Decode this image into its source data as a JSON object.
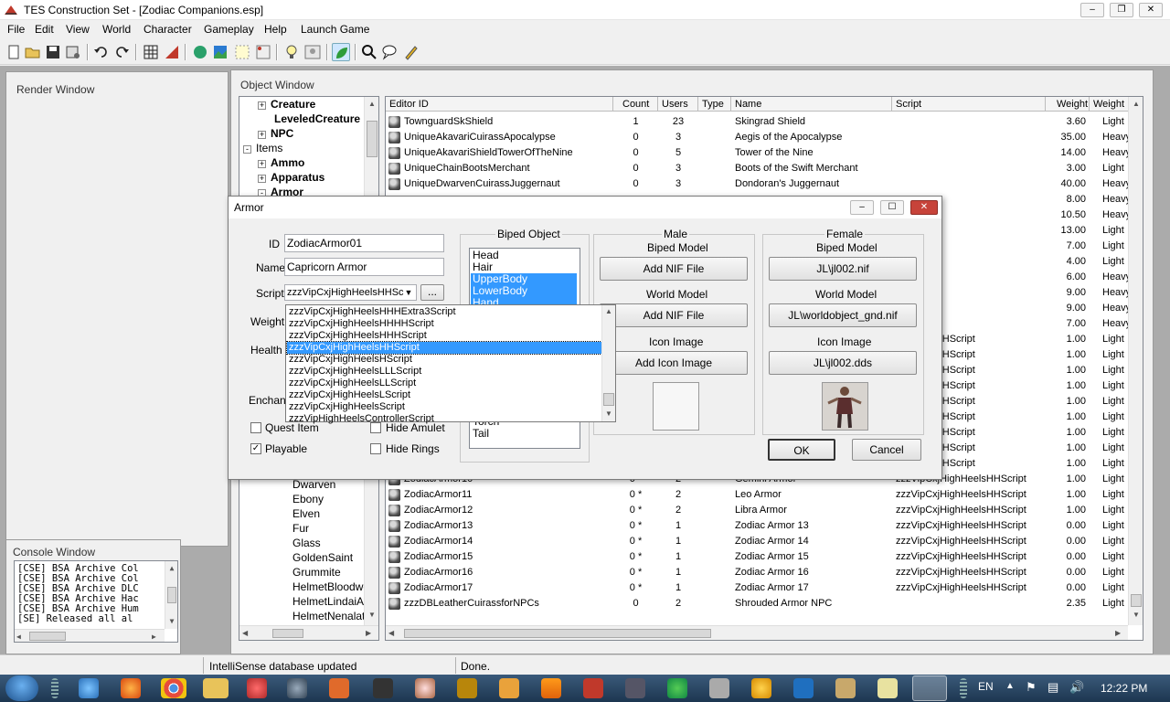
{
  "app": {
    "title": "TES Construction Set - [Zodiac Companions.esp]",
    "menu": [
      "File",
      "Edit",
      "View",
      "World",
      "Character",
      "Gameplay",
      "Help",
      "Launch Game"
    ]
  },
  "render_window": {
    "title": "Render Window"
  },
  "console": {
    "title": "Console Window",
    "lines": [
      "[CSE]   BSA Archive Col",
      "[CSE]   BSA Archive Col",
      "[CSE]   BSA Archive DLC",
      "[CSE]   BSA Archive Hac",
      "[CSE]   BSA Archive Hum",
      "[SE]    Released all al"
    ]
  },
  "object_window": {
    "title": "Object Window",
    "tree_top": [
      {
        "label": "Creature",
        "expander": "+",
        "level": 2
      },
      {
        "label": "LeveledCreature",
        "expander": "",
        "level": 2
      },
      {
        "label": "NPC",
        "expander": "+",
        "level": 2
      },
      {
        "label": "Items",
        "expander": "-",
        "level": 1
      },
      {
        "label": "Ammo",
        "expander": "+",
        "level": 2
      },
      {
        "label": "Apparatus",
        "expander": "+",
        "level": 2
      },
      {
        "label": "Armor",
        "expander": "-",
        "level": 2
      }
    ],
    "tree_bottom": [
      "Dwarven",
      "Ebony",
      "Elven",
      "Fur",
      "Glass",
      "GoldenSaint",
      "Grummite",
      "HelmetBloodwor",
      "HelmetLindaiAy",
      "HelmetNenalata"
    ],
    "columns": [
      "Editor ID",
      "Count",
      "Users",
      "Type",
      "Name",
      "Script",
      "Weight",
      "Weight"
    ],
    "rows_top": [
      {
        "id": "TownguardSkShield",
        "count": "1",
        "users": "23",
        "type": "",
        "name": "Skingrad Shield",
        "script": "",
        "weight": "3.60",
        "wtype": "Light"
      },
      {
        "id": "UniqueAkavariCuirassApocalypse",
        "count": "0",
        "users": "3",
        "type": "",
        "name": "Aegis of the Apocalypse",
        "script": "",
        "weight": "35.00",
        "wtype": "Heavy"
      },
      {
        "id": "UniqueAkavariShieldTowerOfTheNine",
        "count": "0",
        "users": "5",
        "type": "",
        "name": "Tower of the Nine",
        "script": "",
        "weight": "14.00",
        "wtype": "Heavy"
      },
      {
        "id": "UniqueChainBootsMerchant",
        "count": "0",
        "users": "3",
        "type": "",
        "name": "Boots of the Swift Merchant",
        "script": "",
        "weight": "3.00",
        "wtype": "Light"
      },
      {
        "id": "UniqueDwarvenCuirassJuggernaut",
        "count": "0",
        "users": "3",
        "type": "",
        "name": "Dondoran's Juggernaut",
        "script": "",
        "weight": "40.00",
        "wtype": "Heavy"
      }
    ],
    "rows_hidden": [
      {
        "script": "",
        "weight": "8.00",
        "wtype": "Heavy"
      },
      {
        "script": "",
        "weight": "10.50",
        "wtype": "Heavy"
      },
      {
        "script": "",
        "weight": "13.00",
        "wtype": "Light"
      },
      {
        "script": "",
        "weight": "7.00",
        "wtype": "Light"
      },
      {
        "script": "",
        "weight": "4.00",
        "wtype": "Light"
      },
      {
        "script": "",
        "weight": "6.00",
        "wtype": "Heavy"
      },
      {
        "script": "",
        "weight": "9.00",
        "wtype": "Heavy"
      },
      {
        "script": "",
        "weight": "9.00",
        "wtype": "Heavy"
      },
      {
        "script": "",
        "weight": "7.00",
        "wtype": "Heavy"
      },
      {
        "script": "ighHeelsHHScript",
        "weight": "1.00",
        "wtype": "Light"
      },
      {
        "script": "ighHeelsHHScript",
        "weight": "1.00",
        "wtype": "Light"
      },
      {
        "script": "ighHeelsHHScript",
        "weight": "1.00",
        "wtype": "Light"
      },
      {
        "script": "ighHeelsHHScript",
        "weight": "1.00",
        "wtype": "Light"
      },
      {
        "script": "ighHeelsHHScript",
        "weight": "1.00",
        "wtype": "Light"
      },
      {
        "script": "ighHeelsHHScript",
        "weight": "1.00",
        "wtype": "Light"
      },
      {
        "script": "ighHeelsHHScript",
        "weight": "1.00",
        "wtype": "Light"
      },
      {
        "script": "ighHeelsHHScript",
        "weight": "1.00",
        "wtype": "Light"
      },
      {
        "script": "ighHeelsHHScript",
        "weight": "1.00",
        "wtype": "Light"
      }
    ],
    "rows_bottom": [
      {
        "id": "ZodiacArmor10",
        "count": "0 *",
        "users": "2",
        "type": "",
        "name": "Gemini Armor",
        "script": "zzzVipCxjHighHeelsHHScript",
        "weight": "1.00",
        "wtype": "Light"
      },
      {
        "id": "ZodiacArmor11",
        "count": "0 *",
        "users": "2",
        "type": "",
        "name": "Leo Armor",
        "script": "zzzVipCxjHighHeelsHHScript",
        "weight": "1.00",
        "wtype": "Light"
      },
      {
        "id": "ZodiacArmor12",
        "count": "0 *",
        "users": "2",
        "type": "",
        "name": "Libra Armor",
        "script": "zzzVipCxjHighHeelsHHScript",
        "weight": "1.00",
        "wtype": "Light"
      },
      {
        "id": "ZodiacArmor13",
        "count": "0 *",
        "users": "1",
        "type": "",
        "name": "Zodiac Armor 13",
        "script": "zzzVipCxjHighHeelsHHScript",
        "weight": "0.00",
        "wtype": "Light"
      },
      {
        "id": "ZodiacArmor14",
        "count": "0 *",
        "users": "1",
        "type": "",
        "name": "Zodiac Armor 14",
        "script": "zzzVipCxjHighHeelsHHScript",
        "weight": "0.00",
        "wtype": "Light"
      },
      {
        "id": "ZodiacArmor15",
        "count": "0 *",
        "users": "1",
        "type": "",
        "name": "Zodiac Armor 15",
        "script": "zzzVipCxjHighHeelsHHScript",
        "weight": "0.00",
        "wtype": "Light"
      },
      {
        "id": "ZodiacArmor16",
        "count": "0 *",
        "users": "1",
        "type": "",
        "name": "Zodiac Armor 16",
        "script": "zzzVipCxjHighHeelsHHScript",
        "weight": "0.00",
        "wtype": "Light"
      },
      {
        "id": "ZodiacArmor17",
        "count": "0 *",
        "users": "1",
        "type": "",
        "name": "Zodiac Armor 17",
        "script": "zzzVipCxjHighHeelsHHScript",
        "weight": "0.00",
        "wtype": "Light"
      },
      {
        "id": "zzzDBLeatherCuirassforNPCs",
        "count": "0",
        "users": "2",
        "type": "",
        "name": "Shrouded Armor NPC",
        "script": "",
        "weight": "2.35",
        "wtype": "Light"
      }
    ]
  },
  "armor_dialog": {
    "title": "Armor",
    "labels": {
      "id": "ID",
      "name": "Name",
      "script": "Script",
      "weight": "Weight",
      "health": "Health",
      "enchant": "Enchan"
    },
    "id_value": "ZodiacArmor01",
    "name_value": "Capricorn Armor",
    "script_value": "zzzVipCxjHighHeelsHHSc",
    "browse_label": "...",
    "script_options": [
      "zzzVipCxjHighHeelsHHHExtra3Script",
      "zzzVipCxjHighHeelsHHHHScript",
      "zzzVipCxjHighHeelsHHHScript",
      "zzzVipCxjHighHeelsHHScript",
      "zzzVipCxjHighHeelsHScript",
      "zzzVipCxjHighHeelsLLLScript",
      "zzzVipCxjHighHeelsLLScript",
      "zzzVipCxjHighHeelsLScript",
      "zzzVipCxjHighHeelsScript",
      "zzzVipHighHeelsControllerScript"
    ],
    "script_selected_index": 3,
    "biped_object": {
      "title": "Biped Object",
      "items_top": [
        "Head",
        "Hair",
        "UpperBody",
        "LowerBody",
        "Hand"
      ],
      "items_bottom": [
        "Torch",
        "Tail"
      ],
      "selected": [
        "UpperBody",
        "LowerBody",
        "Hand"
      ]
    },
    "male": {
      "title": "Male",
      "biped_model_label": "Biped Model",
      "biped_model_button": "Add NIF File",
      "world_model_label": "World Model",
      "world_model_button": "Add NIF File",
      "icon_label": "Icon Image",
      "icon_button": "Add Icon Image"
    },
    "female": {
      "title": "Female",
      "biped_model_label": "Biped Model",
      "biped_model_button": "JL\\jl002.nif",
      "world_model_label": "World Model",
      "world_model_button": "JL\\worldobject_gnd.nif",
      "icon_label": "Icon Image",
      "icon_button": "JL\\jl002.dds"
    },
    "checkboxes": {
      "quest_item": "Quest Item",
      "quest_item_checked": false,
      "playable": "Playable",
      "playable_checked": true,
      "hide_amulet": "Hide Amulet",
      "hide_amulet_checked": false,
      "hide_rings": "Hide Rings",
      "hide_rings_checked": false
    },
    "ok_label": "OK",
    "cancel_label": "Cancel"
  },
  "status_bar": {
    "left": "IntelliSense database updated",
    "right": "Done."
  },
  "taskbar": {
    "lang": "EN",
    "time": "12:22 PM"
  },
  "colors": {
    "selection": "#3399ff",
    "mdi_background": "#ababab",
    "close_button": "#c7433a"
  }
}
